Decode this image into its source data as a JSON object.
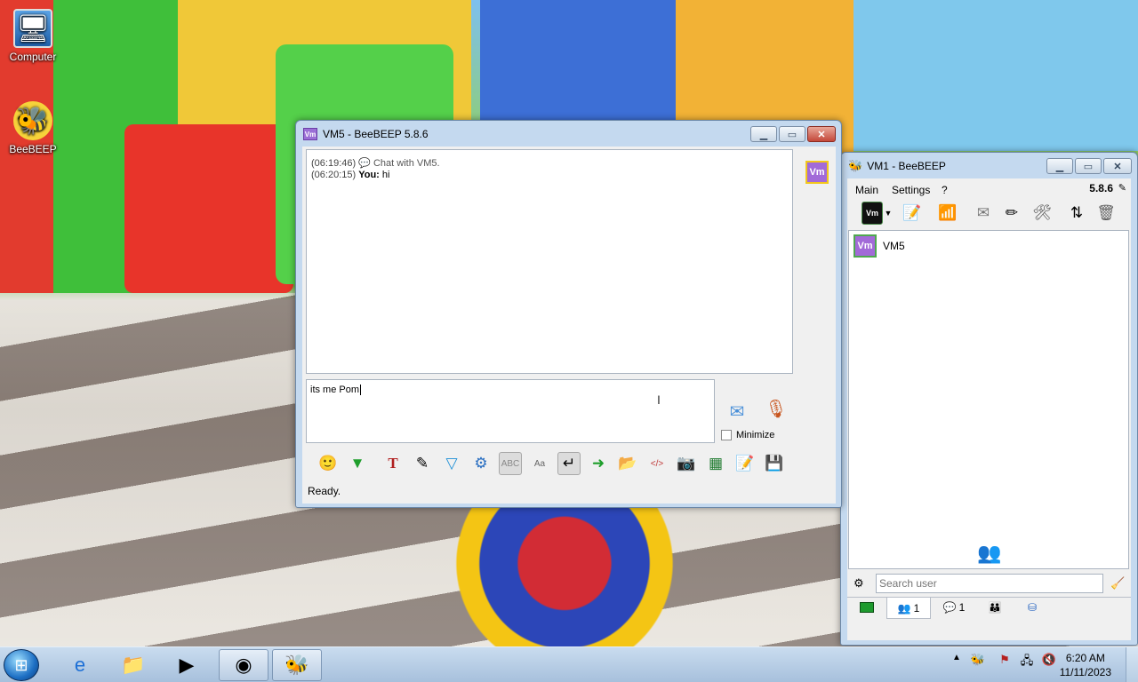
{
  "desktop": {
    "icons": [
      {
        "label": "Computer",
        "icon": "computer-icon"
      },
      {
        "label": "BeeBEEP",
        "icon": "bee-icon"
      }
    ]
  },
  "chat_window": {
    "title": "VM5 - BeeBEEP 5.8.6",
    "avatar": "Vm",
    "messages": [
      {
        "time": "(06:19:46)",
        "sender": "",
        "text": "Chat with VM5."
      },
      {
        "time": "(06:20:15)",
        "sender": "You:",
        "text": "hi"
      }
    ],
    "input_value": "its me Pom",
    "minimize_label": "Minimize",
    "status": "Ready.",
    "tools": [
      "emoticon-icon",
      "green-arrow-icon",
      "font-icon",
      "color-palette-icon",
      "filter-icon",
      "settings-gear-icon",
      "spellcheck-icon",
      "word-completion-icon",
      "enter-send-icon",
      "file-send-icon",
      "folder-send-icon",
      "code-icon",
      "screenshot-icon",
      "terminal-icon",
      "notes-icon",
      "save-icon"
    ]
  },
  "main_window": {
    "title": "VM1 - BeeBEEP",
    "version": "5.8.6",
    "menu": [
      "Main",
      "Settings",
      "?"
    ],
    "avatar": "Vm",
    "users": [
      {
        "name": "VM5",
        "avatar": "Vm"
      }
    ],
    "search_placeholder": "Search user",
    "tabs": [
      {
        "icon": "screen-icon",
        "count": ""
      },
      {
        "icon": "users-icon",
        "count": "1"
      },
      {
        "icon": "chat-icon",
        "count": "1"
      },
      {
        "icon": "groups-icon",
        "count": ""
      },
      {
        "icon": "share-icon",
        "count": ""
      }
    ]
  },
  "taskbar": {
    "clock_time": "6:20 AM",
    "clock_date": "11/11/2023"
  }
}
